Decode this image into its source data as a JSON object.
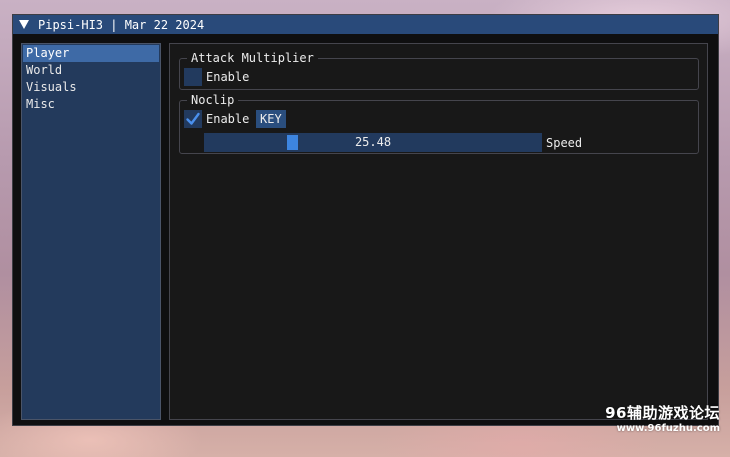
{
  "window": {
    "title": "Pipsi-HI3 | Mar 22 2024",
    "accent_color": "#294a7a"
  },
  "sidebar": {
    "items": [
      {
        "label": "Player",
        "active": true
      },
      {
        "label": "World",
        "active": false
      },
      {
        "label": "Visuals",
        "active": false
      },
      {
        "label": "Misc",
        "active": false
      }
    ]
  },
  "main": {
    "attack_multiplier": {
      "title": "Attack Multiplier",
      "enable_label": "Enable",
      "enabled": false
    },
    "noclip": {
      "title": "Noclip",
      "enable_label": "Enable",
      "enabled": true,
      "key_label": "KEY",
      "speed_value": "25.48",
      "speed_label": "Speed",
      "speed_fraction": 0.25
    }
  },
  "icons": {
    "collapse": "triangle-down-icon",
    "checkmark": "checkmark-icon"
  },
  "watermark": {
    "title": "96辅助游戏论坛",
    "url": "www.96fuzhu.com"
  }
}
